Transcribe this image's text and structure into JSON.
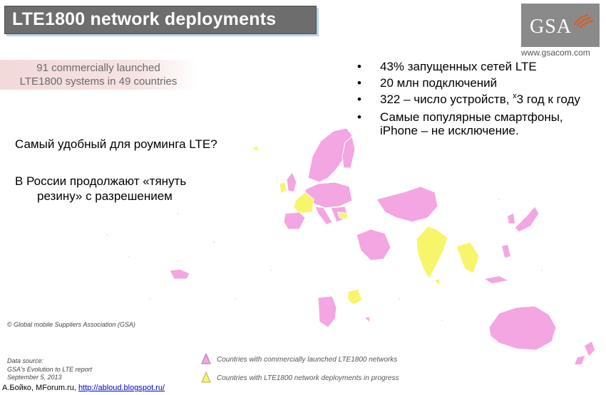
{
  "title": "LTE1800 network deployments",
  "logo": {
    "text": "GSA",
    "url": "www.gsacom.com"
  },
  "launched": {
    "line1": "91 commercially launched",
    "line2": "LTE1800 systems in 49 countries"
  },
  "bullets": [
    {
      "text": "43% запущенных сетей LTE"
    },
    {
      "text": "20 млн подключений"
    },
    {
      "pre": "322 – число устройств, ",
      "sup": "x",
      "post": "3 год к году"
    },
    {
      "text": "Самые популярные смартфоны, iPhone – не исключение."
    }
  ],
  "bullet_symbol": "•",
  "question": "Самый удобный для роуминга LTE?",
  "russia": {
    "line1": "В России продолжают «тянуть",
    "line2": "резину» с разрешением"
  },
  "copyright": "© Global mobile Suppliers Association (GSA)",
  "source": {
    "line1": "Data source:",
    "line2": "GSA's Evolution to LTE report",
    "line3": "September 5, 2013"
  },
  "legend": {
    "launched": "Countries with commercially launched LTE1800 networks",
    "progress": "Countries with LTE1800 network deployments in progress"
  },
  "author": {
    "prefix": "А.Бойко, MForum.ru, ",
    "link": "http://abloud.blogspot.ru/"
  },
  "colors": {
    "launched": "#f3a6e1",
    "progress": "#f7f56a",
    "title_bg": "#6d6d6d",
    "logo_bg": "#8a8a8a"
  }
}
